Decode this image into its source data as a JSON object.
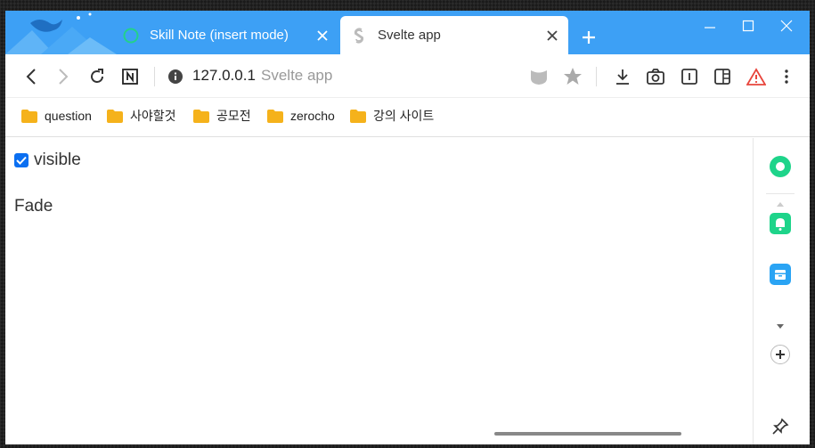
{
  "tabs": [
    {
      "title": "Skill Note (insert mode)",
      "favicon": "circle-outline-icon",
      "active": false
    },
    {
      "title": "Svelte app",
      "favicon": "svelte-icon",
      "active": true
    }
  ],
  "address_bar": {
    "host": "127.0.0.1",
    "page_title": "Svelte app"
  },
  "bookmarks": [
    {
      "label": "question"
    },
    {
      "label": "사야할것"
    },
    {
      "label": "공모전"
    },
    {
      "label": "zerocho"
    },
    {
      "label": "강의 사이트"
    }
  ],
  "content": {
    "checkbox_label": "visible",
    "checkbox_checked": true,
    "fade_text": "Fade"
  },
  "colors": {
    "tabstrip": "#3da0f5",
    "accent": "#0b6ff1",
    "warning": "#e8453c"
  }
}
